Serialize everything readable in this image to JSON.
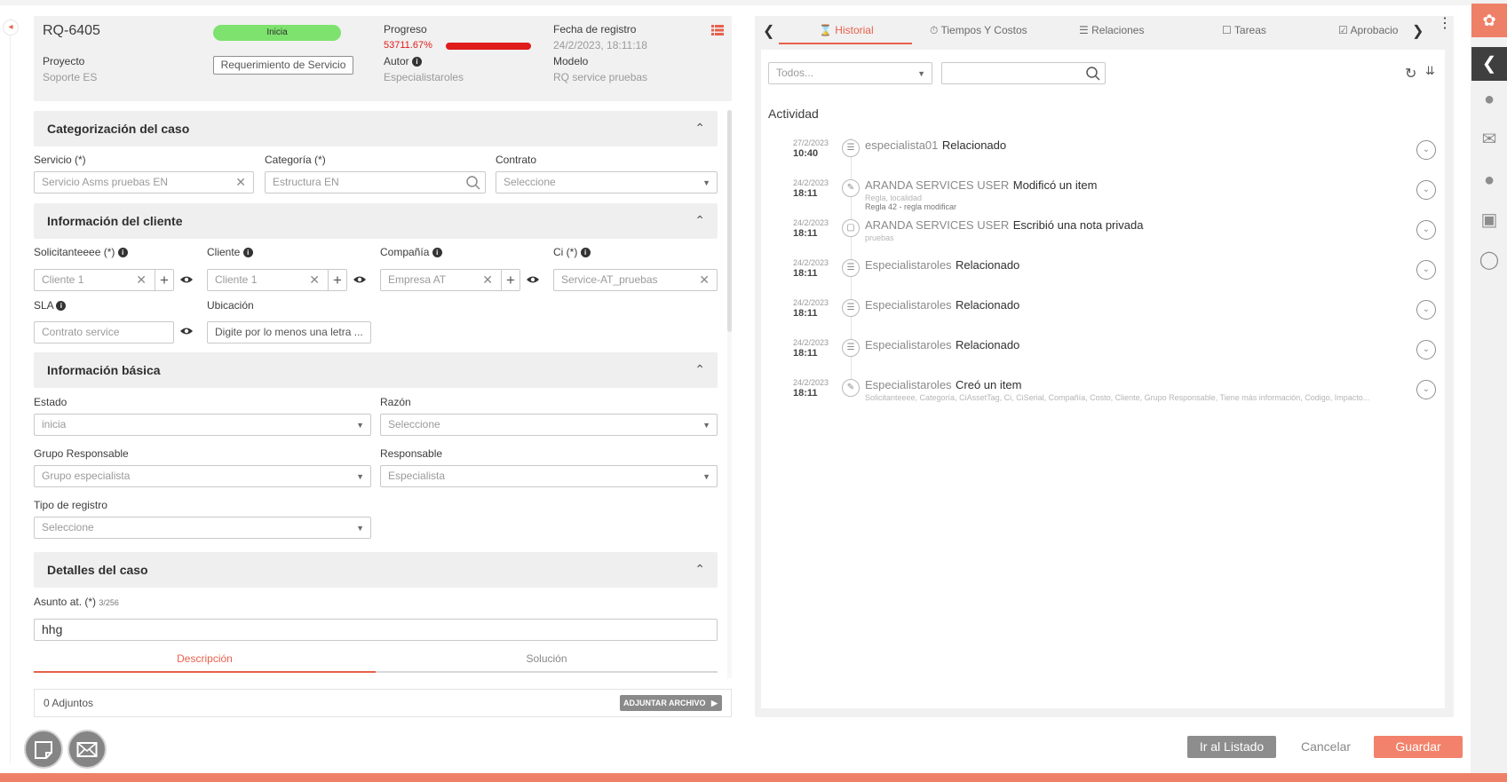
{
  "header": {
    "case_id": "RQ-6405",
    "status_badge": "Inicia",
    "project_label": "Proyecto",
    "project_value": "Soporte ES",
    "type_button": "Requerimiento de Servicio",
    "progress_label": "Progreso",
    "progress_value": "53711.67%",
    "author_label": "Autor",
    "author_value": "Especialistaroles",
    "date_label": "Fecha de registro",
    "date_value": "24/2/2023, 18:11:18",
    "model_label": "Modelo",
    "model_value": "RQ service pruebas",
    "list_icon": "list-icon"
  },
  "sections": {
    "categorization": "Categorización del caso",
    "client_info": "Información del cliente",
    "basic_info": "Información básica",
    "case_details": "Detalles del caso"
  },
  "categorization": {
    "service_label": "Servicio (*)",
    "service_value": "Servicio Asms pruebas EN",
    "category_label": "Categoría (*)",
    "category_value": "Estructura EN",
    "contract_label": "Contrato",
    "contract_placeholder": "Seleccione"
  },
  "client": {
    "requester_label": "Solicitanteeee (*)",
    "requester_value": "Cliente 1",
    "client_label": "Cliente",
    "client_value": "Cliente 1",
    "company_label": "Compañía",
    "company_value": "Empresa AT",
    "ci_label": "Ci (*)",
    "ci_value": "Service-AT_pruebas",
    "sla_label": "SLA",
    "sla_value": "Contrato service",
    "location_label": "Ubicación",
    "location_placeholder": "Digite por lo menos una letra ..."
  },
  "basic": {
    "state_label": "Estado",
    "state_value": "inicia",
    "reason_label": "Razón",
    "reason_placeholder": "Seleccione",
    "group_label": "Grupo Responsable",
    "group_value": "Grupo especialista",
    "responsible_label": "Responsable",
    "responsible_value": "Especialista",
    "record_type_label": "Tipo de registro",
    "record_type_placeholder": "Seleccione"
  },
  "details": {
    "subject_label": "Asunto at. (*)",
    "subject_counter": "3/256",
    "subject_value": "hhg",
    "tab_description": "Descripción",
    "tab_solution": "Solución"
  },
  "attachments": {
    "count_label": "0 Adjuntos",
    "attach_button": "ADJUNTAR ARCHIVO"
  },
  "right_tabs": [
    {
      "label": "Historial",
      "icon": "hourglass-icon"
    },
    {
      "label": "Tiempos Y Costos",
      "icon": "stopwatch-icon"
    },
    {
      "label": "Relaciones",
      "icon": "relations-icon"
    },
    {
      "label": "Tareas",
      "icon": "tasks-icon"
    },
    {
      "label": "Aprobacio",
      "icon": "check-icon"
    }
  ],
  "filter": {
    "select_placeholder": "Todos...",
    "search_value": ""
  },
  "activity": {
    "title": "Actividad",
    "events": [
      {
        "date": "27/2/2023",
        "time": "10:40",
        "user": "especialista01",
        "action": "Relacionado",
        "sub1": "",
        "sub2": "",
        "icon": "relation-icon"
      },
      {
        "date": "24/2/2023",
        "time": "18:11",
        "user": "ARANDA SERVICES USER",
        "action": "Modificó un item",
        "sub1": "Regla, localidad",
        "sub2": "Regla 42 - regla modificar",
        "icon": "edit-doc-icon"
      },
      {
        "date": "24/2/2023",
        "time": "18:11",
        "user": "ARANDA SERVICES USER",
        "action": "Escribió una nota privada",
        "sub1": "pruebas",
        "sub2": "",
        "icon": "note-icon"
      },
      {
        "date": "24/2/2023",
        "time": "18:11",
        "user": "Especialistaroles",
        "action": "Relacionado",
        "sub1": "",
        "sub2": "",
        "icon": "relation-icon"
      },
      {
        "date": "24/2/2023",
        "time": "18:11",
        "user": "Especialistaroles",
        "action": "Relacionado",
        "sub1": "",
        "sub2": "",
        "icon": "relation-icon"
      },
      {
        "date": "24/2/2023",
        "time": "18:11",
        "user": "Especialistaroles",
        "action": "Relacionado",
        "sub1": "",
        "sub2": "",
        "icon": "relation-icon"
      },
      {
        "date": "24/2/2023",
        "time": "18:11",
        "user": "Especialistaroles",
        "action": "Creó un item",
        "sub1": "Solicitanteeee, Categoría, CiAssetTag, Ci, CiSerial, Compañía, Costo, Cliente, Grupo Responsable, Tiene más información, Codigo, Impacto...",
        "sub2": "",
        "icon": "pencil-icon"
      }
    ]
  },
  "footer": {
    "go_list": "Ir al Listado",
    "cancel": "Cancelar",
    "save": "Guardar"
  },
  "colors": {
    "accent": "#e8604c",
    "badge_green": "#7ee26e",
    "progress_red": "#e01b1b",
    "save_orange": "#f2826b"
  }
}
